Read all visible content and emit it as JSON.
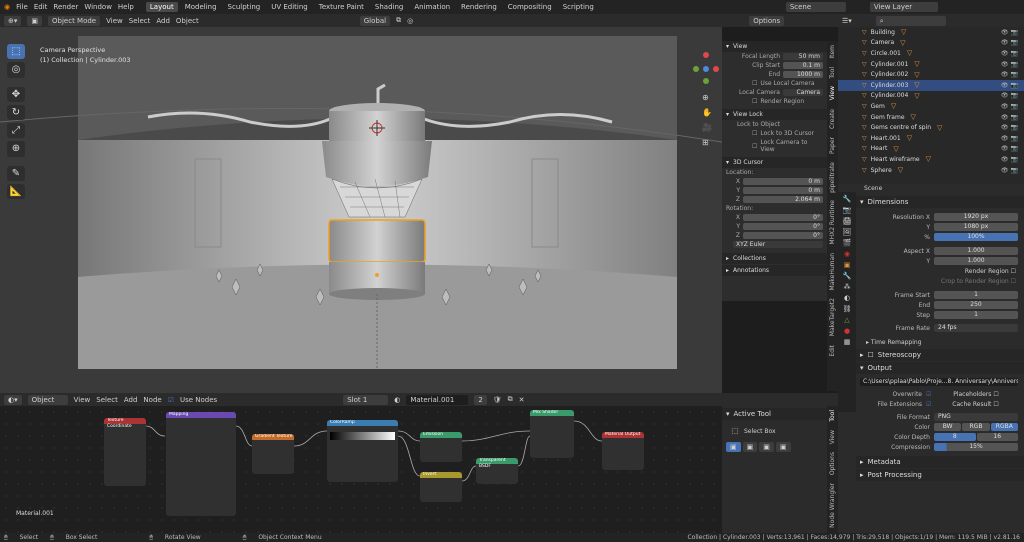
{
  "menu": {
    "items": [
      "File",
      "Edit",
      "Render",
      "Window",
      "Help"
    ]
  },
  "workspaces": [
    "Layout",
    "Modeling",
    "Sculpting",
    "UV Editing",
    "Texture Paint",
    "Shading",
    "Animation",
    "Rendering",
    "Compositing",
    "Scripting"
  ],
  "scene_label": "Scene",
  "view_layer_label": "View Layer",
  "viewport": {
    "mode": "Object Mode",
    "menus": [
      "View",
      "Select",
      "Add",
      "Object"
    ],
    "transform": "Global",
    "options": "Options",
    "camera_label": "Camera Perspective",
    "collection_label": "(1) Collection | Cylinder.003"
  },
  "npanel": {
    "view_title": "View",
    "focal_label": "Focal Length",
    "focal_val": "50 mm",
    "clip_start_label": "Clip Start",
    "clip_start_val": "0.1 m",
    "end_label": "End",
    "end_val": "1000 m",
    "use_local_camera": "Use Local Camera",
    "local_camera_label": "Local Camera",
    "local_camera_val": "Camera",
    "render_region": "Render Region",
    "view_lock": "View Lock",
    "lock_to_object": "Lock to Object",
    "lock_3d_cursor": "Lock to 3D Cursor",
    "lock_camera": "Lock Camera to View",
    "cursor_title": "3D Cursor",
    "location": "Location:",
    "x": "X",
    "y": "Y",
    "z": "Z",
    "lx": "0 m",
    "ly": "0 m",
    "lz": "2.064 m",
    "rotation": "Rotation:",
    "rx": "0°",
    "ry": "0°",
    "rz": "0°",
    "euler": "XYZ Euler",
    "collections": "Collections",
    "annotations": "Annotations"
  },
  "vtabs": [
    "Item",
    "Tool",
    "View",
    "Create",
    "Paper",
    "pipelitrate",
    "MHX2 Runtime",
    "MakeHuman",
    "MakeTarget2",
    "Edit"
  ],
  "outliner": {
    "rows": [
      "Building",
      "Camera",
      "Circle.001",
      "Cylinder.001",
      "Cylinder.002",
      "Cylinder.003",
      "Cylinder.004",
      "Gem",
      "Gem frame",
      "Gems centre of spin",
      "Heart.001",
      "Heart",
      "Heart wireframe",
      "Sphere"
    ]
  },
  "props": {
    "scene": "Scene",
    "dimensions": "Dimensions",
    "res_x_label": "Resolution X",
    "res_x": "1920 px",
    "y_label": "Y",
    "res_y": "1080 px",
    "pct_label": "%",
    "pct": "100%",
    "aspect_label": "Aspect X",
    "aspect_x": "1.000",
    "aspect_y": "1.000",
    "render_region": "Render Region",
    "crop": "Crop to Render Region",
    "frame_start_label": "Frame Start",
    "frame_start": "1",
    "end_label": "End",
    "end": "250",
    "step_label": "Step",
    "step": "1",
    "frame_rate_label": "Frame Rate",
    "frame_rate": "24 fps",
    "time_remap": "Time Remapping",
    "stereoscopy": "Stereoscopy",
    "output": "Output",
    "output_path": "C:\\Users\\pplaa\\Pablo\\Proje...8. Anniversary\\Anniversary",
    "overwrite": "Overwrite",
    "placeholders": "Placeholders",
    "file_ext": "File Extensions",
    "cache_result": "Cache Result",
    "file_format_label": "File Format",
    "file_format": "PNG",
    "color_label": "Color",
    "bw": "BW",
    "rgb": "RGB",
    "rgba": "RGBA",
    "depth_label": "Color Depth",
    "d8": "8",
    "d16": "16",
    "compression_label": "Compression",
    "compression": "15%",
    "metadata": "Metadata",
    "post": "Post Processing"
  },
  "node_editor": {
    "type": "Object",
    "menus": [
      "View",
      "Select",
      "Add",
      "Node"
    ],
    "use_nodes": "Use Nodes",
    "slot": "Slot 1",
    "material": "Material.001",
    "users": "2",
    "material_label": "Material.001",
    "nodes": [
      "Texture Coordinate",
      "Mapping",
      "Gradient Texture",
      "ColorRamp",
      "Emission",
      "Mix Shader",
      "Material Output",
      "Transparent BSDF",
      "Invert"
    ]
  },
  "active_tool": {
    "title": "Active Tool",
    "select_box": "Select Box"
  },
  "ne_tabs": [
    "Tool",
    "View",
    "Options",
    "Node Wrangler"
  ],
  "status": {
    "select": "Select",
    "box_select": "Box Select",
    "rotate": "Rotate View",
    "context": "Object Context Menu",
    "info": "Collection | Cylinder.003 | Verts:13,961 | Faces:14,979 | Tris:29,518 | Objects:1/19 | Mem: 119.5 MiB | v2.81.16"
  }
}
